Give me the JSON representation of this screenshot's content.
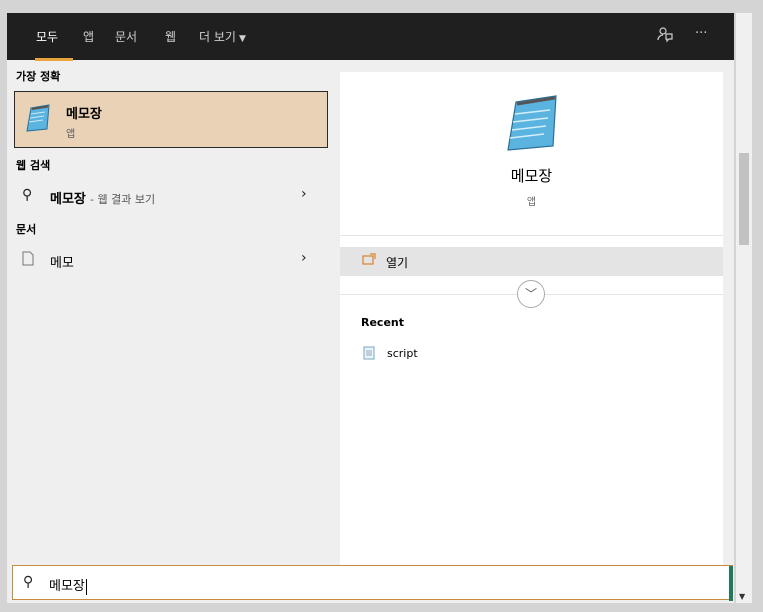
{
  "tabs": [
    {
      "label": "모두",
      "active": true
    },
    {
      "label": "앱"
    },
    {
      "label": "문서"
    },
    {
      "label": "웹"
    },
    {
      "label": "더 보기"
    }
  ],
  "toolbar_icons": [
    "feedback-icon",
    "more-icon"
  ],
  "more_glyph": "···",
  "best_match": {
    "heading": "가장 정확",
    "name": "메모장",
    "type": "앱",
    "icon": "notepad-icon"
  },
  "web_search": {
    "heading": "웹 검색",
    "query": "메모장",
    "suffix": "- 웹 결과 보기"
  },
  "documents": {
    "heading": "문서",
    "items": [
      {
        "name": "메모"
      }
    ]
  },
  "detail": {
    "name": "메모장",
    "type": "앱",
    "actions": [
      {
        "label": "열기",
        "icon": "open-icon"
      }
    ],
    "recent_heading": "Recent",
    "recent": [
      {
        "name": "script",
        "icon": "text-file-icon"
      }
    ]
  },
  "search": {
    "value": "메모장",
    "icon": "search-icon"
  },
  "colors": {
    "topbar": "#1f1f1f",
    "accent": "#e8a33d",
    "best_match_bg": "#e9d2b6"
  }
}
